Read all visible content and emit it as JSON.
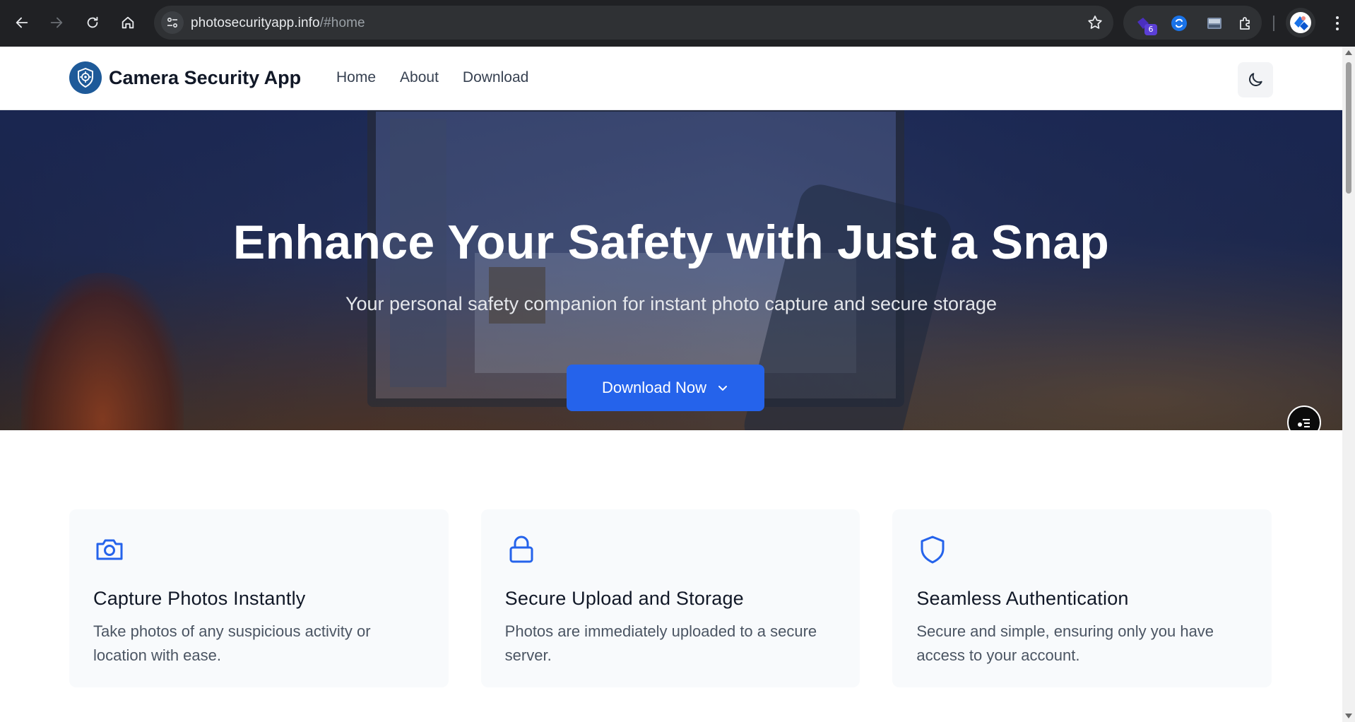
{
  "browser": {
    "url_host": "photosecurityapp.info",
    "url_path": "/#home",
    "extension_badge": "6"
  },
  "site": {
    "brand_name": "Camera Security App",
    "nav": [
      {
        "label": "Home"
      },
      {
        "label": "About"
      },
      {
        "label": "Download"
      }
    ]
  },
  "hero": {
    "title": "Enhance Your Safety with Just a Snap",
    "subtitle": "Your personal safety companion for instant photo capture and secure storage",
    "cta_label": "Download Now"
  },
  "features": [
    {
      "icon": "camera-icon",
      "title": "Capture Photos Instantly",
      "description": "Take photos of any suspicious activity or location with ease."
    },
    {
      "icon": "lock-icon",
      "title": "Secure Upload and Storage",
      "description": "Photos are immediately uploaded to a secure server."
    },
    {
      "icon": "shield-icon",
      "title": "Seamless Authentication",
      "description": "Secure and simple, ensuring only you have access to your account."
    }
  ],
  "colors": {
    "accent": "#2563eb",
    "brand_logo": "#1e5a99",
    "chrome_bg": "#202124"
  }
}
